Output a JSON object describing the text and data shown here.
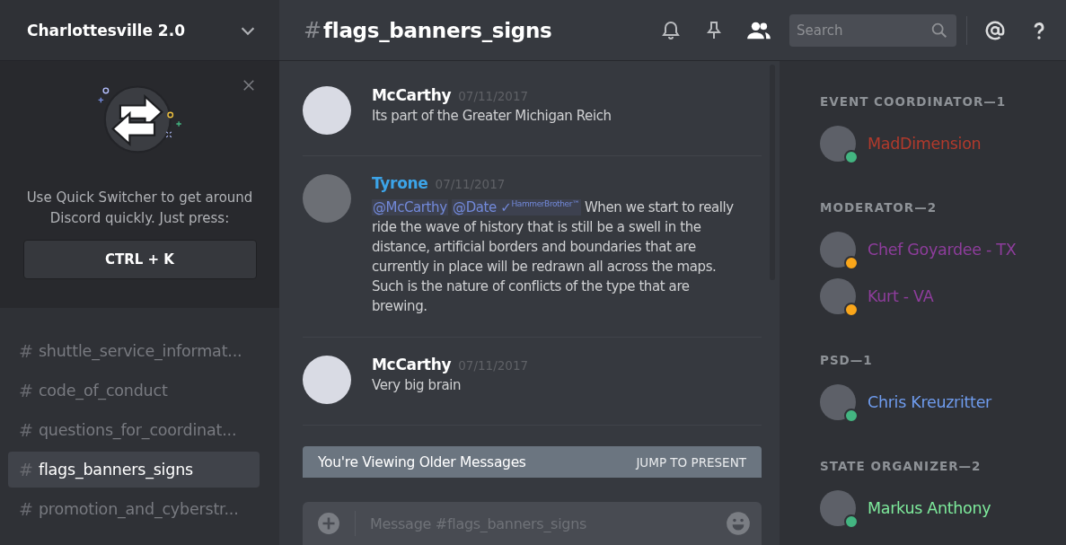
{
  "server": {
    "name": "Charlottesville 2.0"
  },
  "quick_switcher": {
    "text": "Use Quick Switcher to get around Discord quickly. Just press:",
    "shortcut": "CTRL + K"
  },
  "channels": [
    {
      "hash": "#",
      "name": "shuttle_service_informat...",
      "selected": false
    },
    {
      "hash": "#",
      "name": "code_of_conduct",
      "selected": false
    },
    {
      "hash": "#",
      "name": "questions_for_coordinat...",
      "selected": false
    },
    {
      "hash": "#",
      "name": "flags_banners_signs",
      "selected": true
    },
    {
      "hash": "#",
      "name": "promotion_and_cyberstr...",
      "selected": false
    }
  ],
  "header": {
    "hash": "#",
    "channel": "flags_banners_signs",
    "search": {
      "placeholder": "Search"
    }
  },
  "messages": [
    {
      "author": "McCarthy",
      "color": "#ffffff",
      "time": "07/11/2017",
      "parts": [
        {
          "kind": "text",
          "text": "Its part of the Greater Michigan Reich"
        }
      ]
    },
    {
      "author": "Tyrone",
      "color": "#3ca4e8",
      "time": "07/11/2017",
      "parts": [
        {
          "kind": "mention",
          "text": "@McCarthy"
        },
        {
          "kind": "mention",
          "text": "@Date ✓$^{HammerBrother™}$"
        },
        {
          "kind": "text",
          "text": "When we start to really ride the wave of history that is still be a swell in the distance, artificial borders and boundaries that are currently in place will be redrawn all across the maps. Such is the nature of conflicts of the type that are brewing."
        }
      ]
    },
    {
      "author": "McCarthy",
      "color": "#ffffff",
      "time": "07/11/2017",
      "parts": [
        {
          "kind": "text",
          "text": "Very big brain"
        }
      ]
    }
  ],
  "older_banner": {
    "text": "You're Viewing Older Messages",
    "action": "JUMP TO PRESENT"
  },
  "composer": {
    "placeholder": "Message #flags_banners_signs"
  },
  "member_groups": [
    {
      "title": "EVENT COORDINATOR—1",
      "members": [
        {
          "name": "MadDimension",
          "color": "#b23a2c",
          "status": {
            "color": "#43b581"
          }
        }
      ]
    },
    {
      "title": "MODERATOR—2",
      "members": [
        {
          "name": "Chef Goyardee - TX",
          "color": "#8e3d9c",
          "status": {
            "color": "#faa61a"
          }
        },
        {
          "name": "Kurt - VA",
          "color": "#8e3d9c",
          "status": {
            "color": "#faa61a"
          }
        }
      ]
    },
    {
      "title": "PSD—1",
      "members": [
        {
          "name": "Chris Kreuzritter",
          "color": "#6f9cee",
          "status": {
            "color": "#43b581"
          }
        }
      ]
    },
    {
      "title": "STATE ORGANIZER—2",
      "members": [
        {
          "name": "Markus Anthony",
          "color": "#7eeb9c",
          "status": {
            "color": "#43b581"
          }
        }
      ]
    }
  ]
}
